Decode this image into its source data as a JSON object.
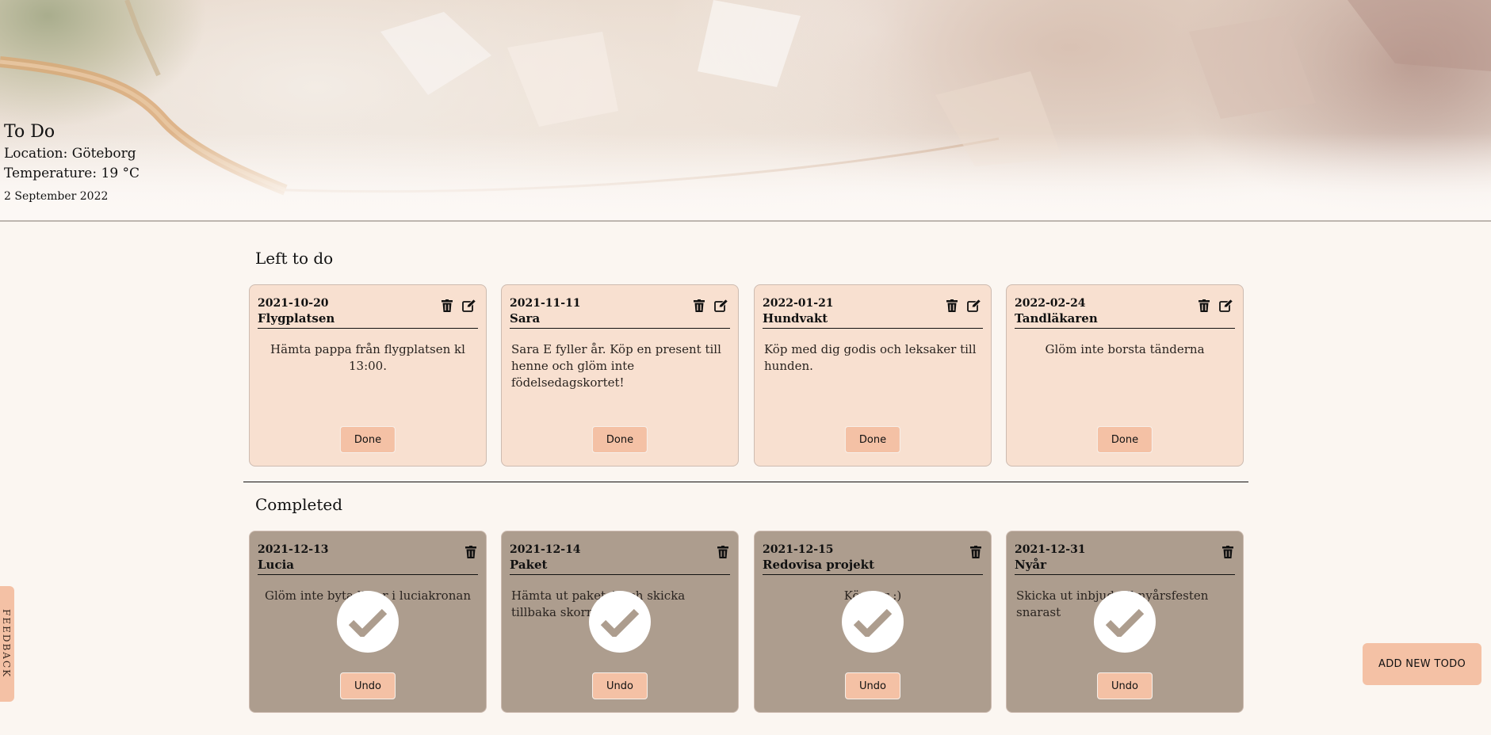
{
  "header": {
    "title": "To Do",
    "location": "Location: Göteborg",
    "temperature": "Temperature: 19 °C",
    "date": "2 September 2022"
  },
  "sections": {
    "left_title": "Left to do",
    "completed_title": "Completed"
  },
  "todos": [
    {
      "date": "2021-10-20",
      "name": "Flygplatsen",
      "desc": "Hämta pappa från flygplatsen kl 13:00.",
      "button": "Done"
    },
    {
      "date": "2021-11-11",
      "name": "Sara",
      "desc": "Sara E fyller år. Köp en present till henne och glöm inte födelsedagskortet!",
      "button": "Done"
    },
    {
      "date": "2022-01-21",
      "name": "Hundvakt",
      "desc": "Köp med dig godis och leksaker till hunden.",
      "button": "Done"
    },
    {
      "date": "2022-02-24",
      "name": "Tandläkaren",
      "desc": "Glöm inte borsta tänderna",
      "button": "Done"
    }
  ],
  "completed": [
    {
      "date": "2021-12-13",
      "name": "Lucia",
      "desc": "Glöm inte byta ljus r i luciakronan",
      "button": "Undo"
    },
    {
      "date": "2021-12-14",
      "name": "Paket",
      "desc": "Hämta ut paket A och skicka tillbaka skorna",
      "button": "Undo"
    },
    {
      "date": "2021-12-15",
      "name": "Redovisa projekt",
      "desc": "Kör ker :)",
      "button": "Undo"
    },
    {
      "date": "2021-12-31",
      "name": "Nyår",
      "desc": "Skicka ut inbjud till nyårsfesten snarast",
      "button": "Undo"
    }
  ],
  "feedback_label": "FEEDBACK",
  "add_button": "ADD NEW TODO",
  "icons": {
    "delete": "trash-icon",
    "edit": "edit-icon",
    "complete": "check-icon"
  }
}
